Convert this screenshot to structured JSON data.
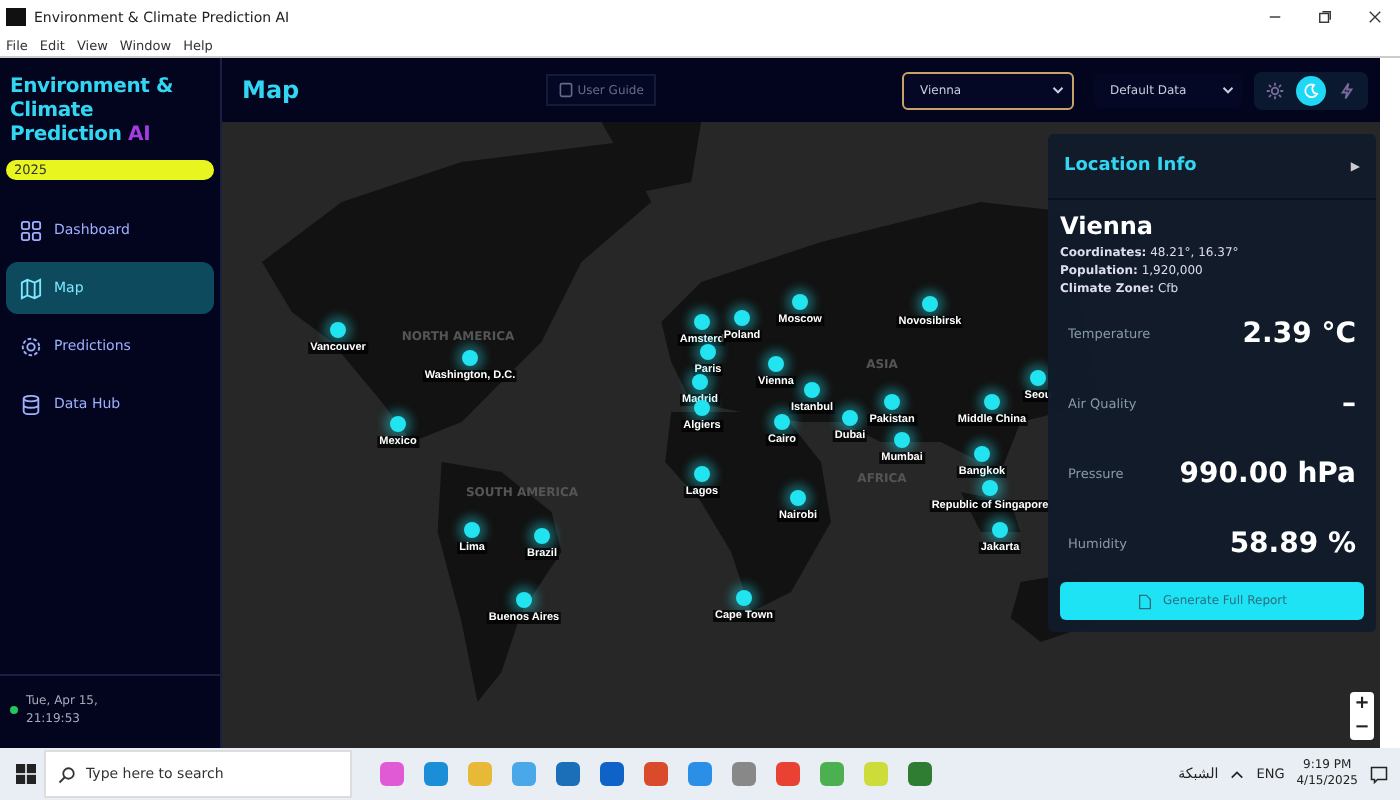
{
  "window": {
    "title": "Environment & Climate Prediction AI",
    "menu": [
      "File",
      "Edit",
      "View",
      "Window",
      "Help"
    ]
  },
  "sidebar": {
    "logo_main": "Environment & Climate Prediction",
    "logo_accent": "AI",
    "year": "2025",
    "items": [
      {
        "label": "Dashboard",
        "selected": false
      },
      {
        "label": "Map",
        "selected": true
      },
      {
        "label": "Predictions",
        "selected": false
      },
      {
        "label": "Data Hub",
        "selected": false
      }
    ],
    "footer": {
      "date": "Tue, Apr 15,",
      "time": "21:19:53"
    }
  },
  "header": {
    "title": "Map",
    "guide_button": "User Guide",
    "location_select": "Vienna",
    "data_select": "Default Data",
    "themes": [
      {
        "selected": false
      },
      {
        "selected": true
      },
      {
        "selected": false
      }
    ]
  },
  "map": {
    "regions": [
      "NORTH AMERICA",
      "SOUTH AMERICA",
      "AFRICA",
      "ASIA"
    ],
    "cities": [
      "Vancouver",
      "Washington, D.C.",
      "Mexico",
      "Lima",
      "Brazil",
      "Buenos Aires",
      "Amsterd",
      "Paris",
      "Madrid",
      "Algiers",
      "Poland",
      "Vienna",
      "Moscow",
      "Novosibirsk",
      "Istanbul",
      "Cairo",
      "Dubai",
      "Pakistan",
      "Mumbai",
      "Middle China",
      "Bangkok",
      "Republic of Singapore",
      "Jakarta",
      "Lagos",
      "Nairobi",
      "Cape Town",
      "Seou"
    ],
    "zoom": [
      "+",
      "−"
    ]
  },
  "location_info": {
    "title": "Location Info",
    "expand": "▶",
    "city": "Vienna",
    "details": [
      "**Coordinates:** 48.21°, 16.37°",
      "**Population:** 1,920,000",
      "**Climate Zone:** Cfb"
    ],
    "metrics": [
      {
        "label": "Temperature",
        "value": "2.39 °C"
      },
      {
        "label": "Air Quality",
        "value": "–"
      },
      {
        "label": "Pressure",
        "value": "990.00 hPa"
      },
      {
        "label": "Humidity",
        "value": "58.89 %"
      }
    ],
    "report_button": "Generate Full Report"
  },
  "taskbar": {
    "search_placeholder": "Type here to search",
    "network": "الشبكة",
    "language": "ENG",
    "time": "9:19 PM",
    "date": "4/15/2025"
  }
}
